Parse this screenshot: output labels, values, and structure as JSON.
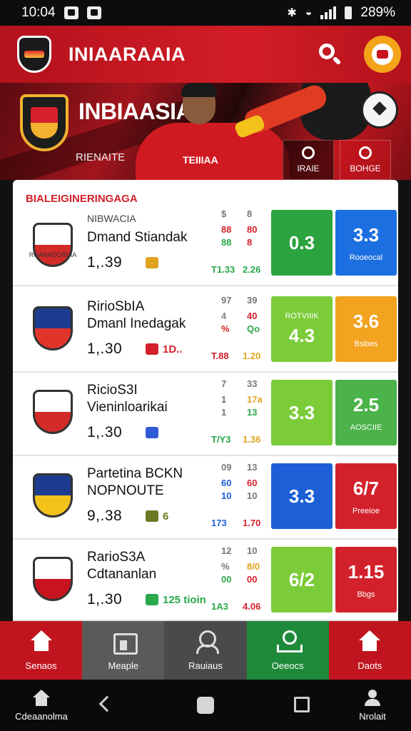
{
  "status_bar": {
    "time": "10:04",
    "battery": "289%"
  },
  "app_bar": {
    "title": "INIAARAAIA"
  },
  "hero": {
    "title": "INBIAASIA",
    "subtitle": "RIENAITE",
    "jersey_text": "TEIIIAA",
    "button_1": "IRAIE",
    "button_2": "BOHGE"
  },
  "section": {
    "title": "BIALEIGINERINGAGA"
  },
  "matches": [
    {
      "name": "NIBWACIA",
      "subtitle": "Dmand Stiandak",
      "kick": "1,.39",
      "crest_caption": "ROANADORIAA",
      "extra": "",
      "stats": [
        "$",
        "8",
        "88",
        "80",
        "88",
        "8",
        "T1.33",
        "2.26"
      ],
      "odds": [
        {
          "value": "0.3",
          "label": "",
          "top": ""
        },
        {
          "value": "3.3",
          "label": "Rooeocal",
          "top": ""
        }
      ],
      "colors": [
        "#2ba33e",
        "#1c6fe0"
      ],
      "crest_colors": [
        "#ffffff",
        "#d32a2a"
      ],
      "extra_color": "#e0a420"
    },
    {
      "name": "RirioSbIA",
      "subtitle": "Dmanl Inedagak",
      "kick": "1,.30",
      "crest_caption": "",
      "extra": "1D..",
      "stats": [
        "97",
        "39",
        "4",
        "40",
        "%",
        "Qo",
        "T.88",
        "1.20"
      ],
      "odds": [
        {
          "value": "4.3",
          "label": "",
          "top": "ROTVIIIK"
        },
        {
          "value": "3.6",
          "label": "Bsibes",
          "top": ""
        }
      ],
      "colors": [
        "#7ccc3a",
        "#f2a31f"
      ],
      "crest_colors": [
        "#1d3c8f",
        "#e2342a"
      ],
      "extra_color": "#d3212b"
    },
    {
      "name": "RicioS3I",
      "subtitle": "Vieninloarikai",
      "kick": "1,.30",
      "crest_caption": "",
      "extra": "",
      "stats": [
        "7",
        "33",
        "1",
        "17a",
        "1",
        "13",
        "T/Y3",
        "1.36"
      ],
      "odds": [
        {
          "value": "3.3",
          "label": "",
          "top": ""
        },
        {
          "value": "2.5",
          "label": "AOSCIIE",
          "top": ""
        }
      ],
      "colors": [
        "#7ccc3a",
        "#4bb34a"
      ],
      "crest_colors": [
        "#ffffff",
        "#d32a2a"
      ],
      "extra_color": "#2f5bd6"
    },
    {
      "name": "Partetina BCKN",
      "subtitle": "NOPNOUTE",
      "kick": "9,.38",
      "crest_caption": "",
      "extra": "6",
      "stats": [
        "09",
        "13",
        "60",
        "60",
        "10",
        "10",
        "173",
        "1.70"
      ],
      "odds": [
        {
          "value": "3.3",
          "label": "",
          "top": ""
        },
        {
          "value": "6/7",
          "label": "Preeioe",
          "top": ""
        }
      ],
      "colors": [
        "#1d5fd6",
        "#d3212b"
      ],
      "crest_colors": [
        "#1d3c8f",
        "#f2c21a"
      ],
      "extra_color": "#6a7a22"
    },
    {
      "name": "RarioS3A",
      "subtitle": "Cdtananlan",
      "kick": "1,.30",
      "crest_caption": "",
      "extra": "125 tioin",
      "stats": [
        "12",
        "10",
        "%",
        "8/0",
        "00",
        "00",
        "1A3",
        "4.06"
      ],
      "odds": [
        {
          "value": "6/2",
          "label": "",
          "top": ""
        },
        {
          "value": "1.15",
          "label": "Bbgs",
          "top": ""
        }
      ],
      "colors": [
        "#7ccc3a",
        "#d3212b"
      ],
      "crest_colors": [
        "#ffffff",
        "#c8141e"
      ],
      "extra_color": "#2aa84a"
    }
  ],
  "tabs": [
    {
      "label": "Senaos",
      "bg": "#c0151f",
      "icon": "house-icon"
    },
    {
      "label": "Meaple",
      "bg": "#5a5a5a",
      "icon": "store-icon"
    },
    {
      "label": "Rauiaus",
      "bg": "#4a4a4a",
      "icon": "people-icon"
    },
    {
      "label": "Oeeocs",
      "bg": "#1f8a3a",
      "icon": "ticket-icon"
    },
    {
      "label": "Daots",
      "bg": "#c0151f",
      "icon": "house-icon"
    }
  ],
  "system_nav": {
    "left_label": "Cdeaanolma",
    "right_label": "Nrolait"
  }
}
